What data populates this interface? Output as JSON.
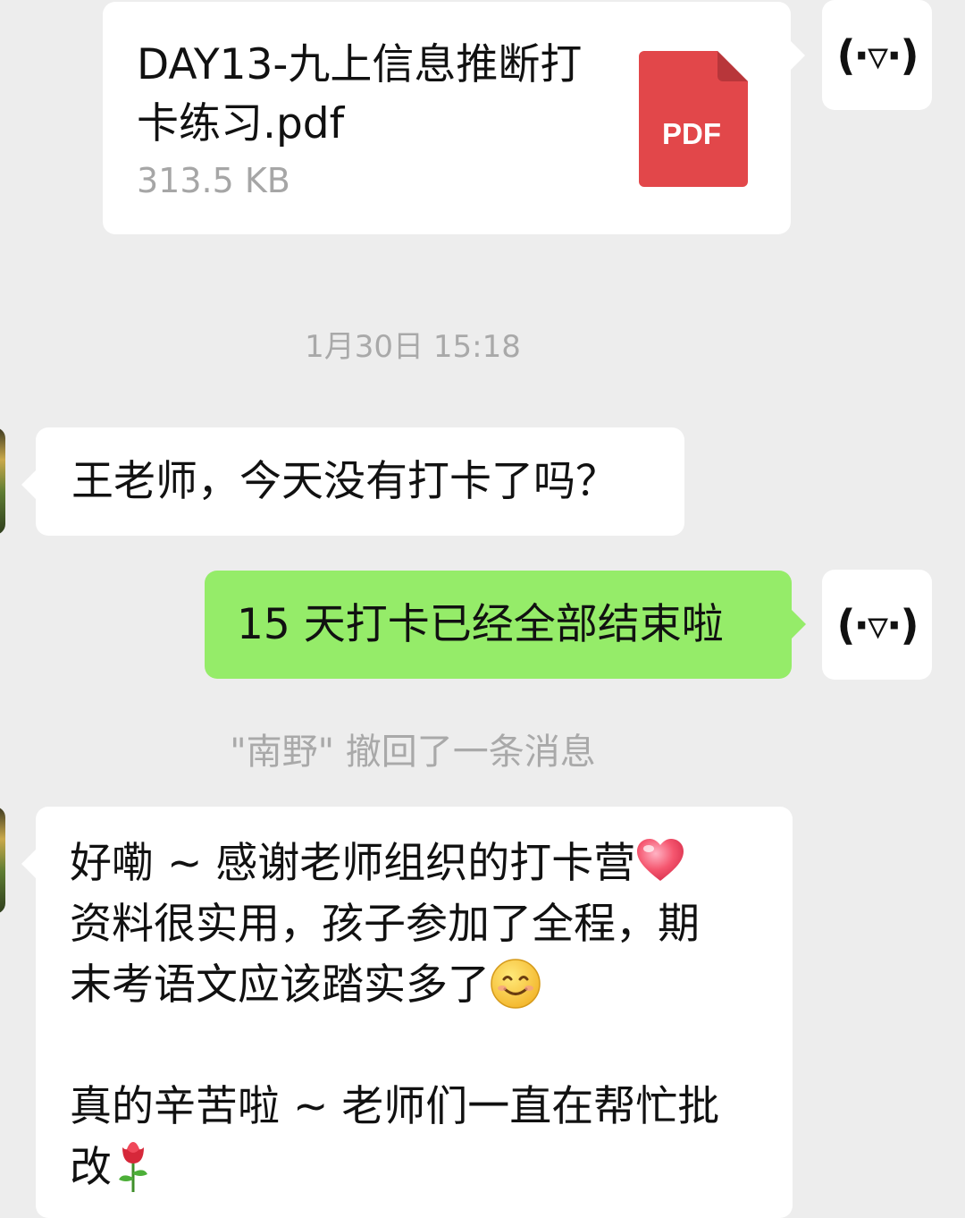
{
  "file_message": {
    "file_name": "DAY13-九上信息推断打卡练习.pdf",
    "file_size": "313.5 KB",
    "file_type_label": "PDF"
  },
  "my_avatar_text": "(·▿·)",
  "timestamp": "1月30日 15:18",
  "messages": [
    {
      "sender": "other",
      "text": "王老师，今天没有打卡了吗？"
    },
    {
      "sender": "me",
      "text": "15 天打卡已经全部结束啦"
    }
  ],
  "recall_notice": "\"南野\" 撤回了一条消息",
  "long_message": {
    "line1_a": "好嘞 ~ 感谢老师组织的打卡营",
    "line2": "资料很实用，孩子参加了全程，期",
    "line3_a": "末考语文应该踏实多了",
    "line4": "真的辛苦啦 ~ 老师们一直在帮忙批",
    "line5_a": "改"
  },
  "colors": {
    "background": "#ededed",
    "my_bubble": "#95ec69",
    "other_bubble": "#ffffff",
    "pdf_red": "#e2474a"
  },
  "icons": [
    "pdf-file-icon",
    "heart-emoji",
    "smile-emoji",
    "rose-emoji"
  ]
}
